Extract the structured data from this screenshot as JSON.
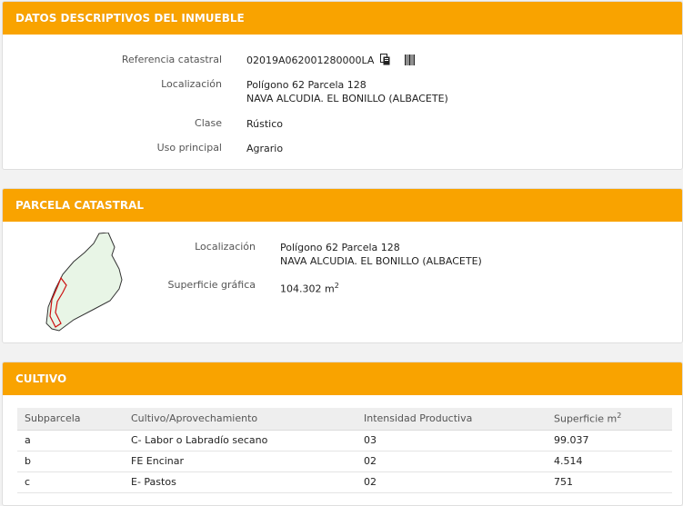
{
  "inmueble": {
    "title": "DATOS DESCRIPTIVOS DEL INMUEBLE",
    "ref_label": "Referencia catastral",
    "ref_value": "02019A062001280000LA",
    "loc_label": "Localización",
    "loc_line1": "Polígono 62 Parcela 128",
    "loc_line2": "NAVA ALCUDIA. EL BONILLO (ALBACETE)",
    "clase_label": "Clase",
    "clase_value": "Rústico",
    "uso_label": "Uso principal",
    "uso_value": "Agrario",
    "icons": [
      "copy-icon",
      "barcode-icon"
    ]
  },
  "parcela": {
    "title": "PARCELA CATASTRAL",
    "loc_label": "Localización",
    "loc_line1": "Polígono 62 Parcela 128",
    "loc_line2": "NAVA ALCUDIA. EL BONILLO (ALBACETE)",
    "sup_label": "Superficie gráfica",
    "sup_value": "104.302 m",
    "sup_unit_exp": "2"
  },
  "cultivo": {
    "title": "CULTIVO",
    "headers": {
      "subparcela": "Subparcela",
      "cultivo": "Cultivo/Aprovechamiento",
      "intensidad": "Intensidad Productiva",
      "superficie": "Superficie m",
      "superficie_exp": "2"
    },
    "rows": [
      {
        "sub": "a",
        "cultivo": "C- Labor o Labradío secano",
        "intensidad": "03",
        "superficie": "99.037"
      },
      {
        "sub": "b",
        "cultivo": "FE Encinar",
        "intensidad": "02",
        "superficie": "4.514"
      },
      {
        "sub": "c",
        "cultivo": "E- Pastos",
        "intensidad": "02",
        "superficie": "751"
      }
    ]
  },
  "colors": {
    "header_bg": "#f9a300",
    "parcel_fill": "#e8f5e6",
    "parcel_highlight": "#cc1111"
  }
}
